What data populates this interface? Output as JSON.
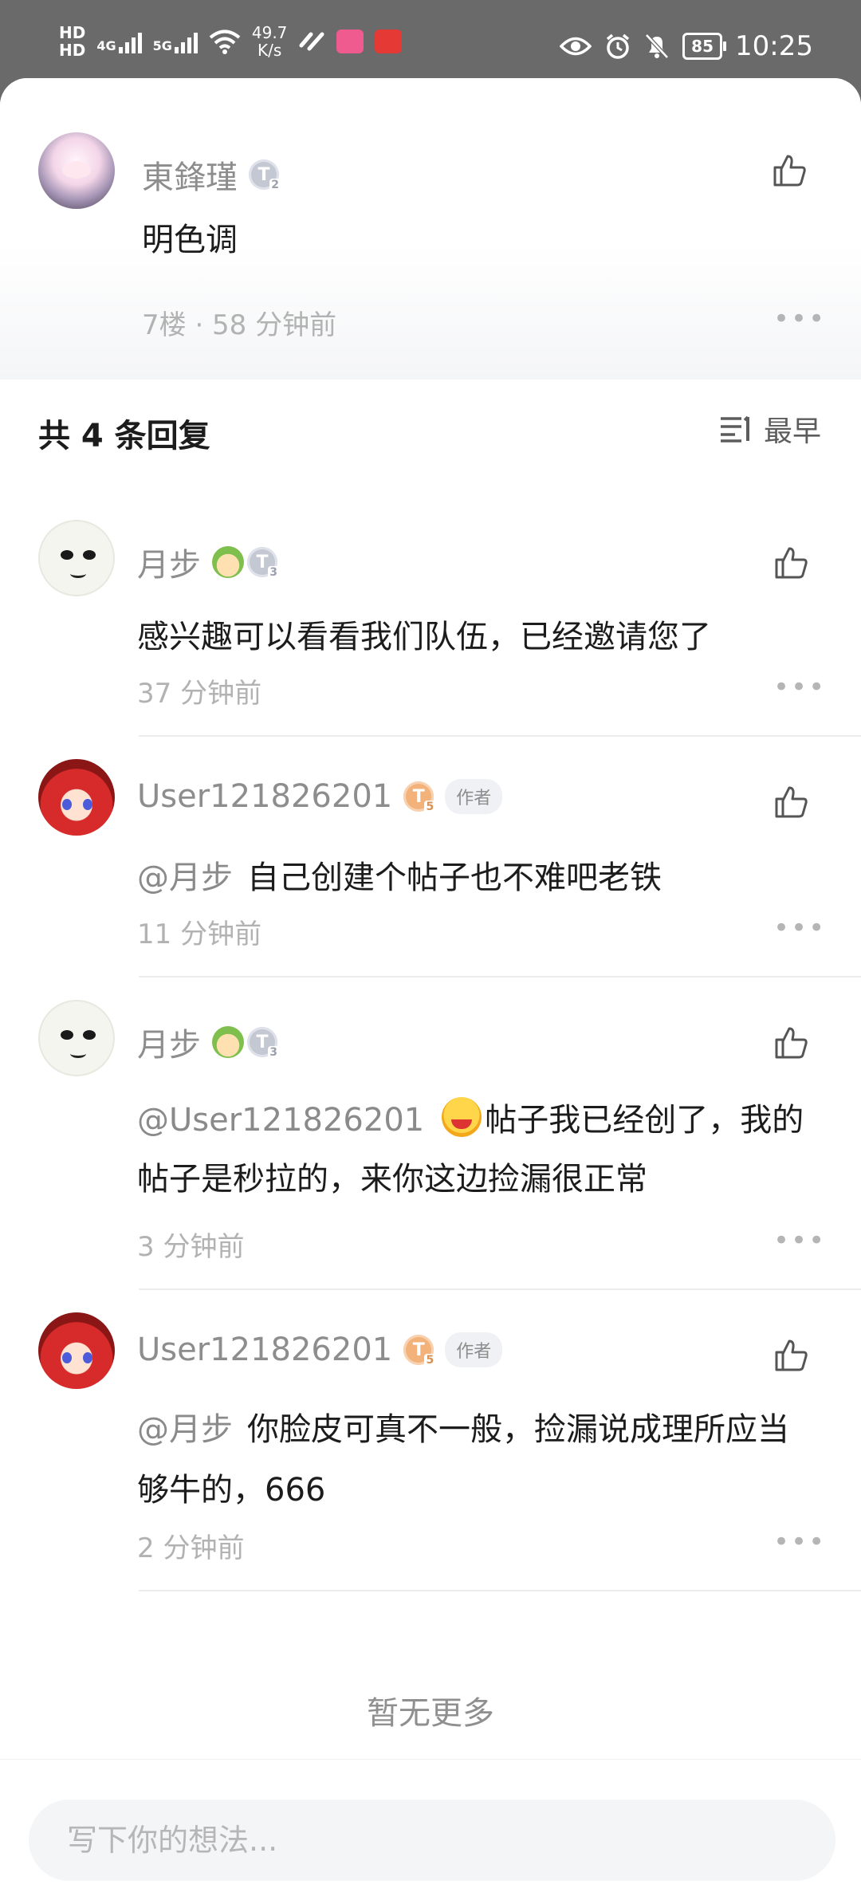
{
  "status_bar": {
    "hd1": "HD",
    "hd2": "HD",
    "sim1_net": "4G",
    "sim2_net": "5G",
    "speed_value": "49.7",
    "speed_unit": "K/s",
    "app1": "Lofter",
    "app2": "起点",
    "battery": "85",
    "time": "10:25"
  },
  "main_post": {
    "username": "東鋒瑾",
    "level": "2",
    "content": "明色调",
    "meta": "7楼 · 58 分钟前"
  },
  "replies_header": {
    "title": "共 4 条回复",
    "sort_label": "最早"
  },
  "replies": [
    {
      "username": "月步",
      "level": "3",
      "author": "",
      "mention": "",
      "content_line1": "感兴趣可以看看我们队伍，已经邀请您了",
      "content_line2": "",
      "time": "37 分钟前"
    },
    {
      "username": "User121826201",
      "level": "5",
      "author": "作者",
      "mention": "@月步",
      "content_line1": "自己创建个帖子也不难吧老铁",
      "content_line2": "",
      "time": "11 分钟前"
    },
    {
      "username": "月步",
      "level": "3",
      "author": "",
      "mention": "@User121826201",
      "content_line1": "帖子我已经创了，我的",
      "content_line2": "帖子是秒拉的，来你这边捡漏很正常",
      "time": "3 分钟前"
    },
    {
      "username": "User121826201",
      "level": "5",
      "author": "作者",
      "mention": "@月步",
      "content_line1": "你脸皮可真不一般，捡漏说成理所应当",
      "content_line2": "够牛的，666",
      "time": "2 分钟前"
    }
  ],
  "footer": {
    "no_more": "暂无更多",
    "input_placeholder": "写下你的想法..."
  },
  "colors": {
    "status_bg": "#6a6a6a",
    "muted_text": "#8d8d8d",
    "primary_text": "#1c1c1c",
    "gold_badge": "#f2b27a",
    "silver_badge": "#c4c8d3"
  }
}
